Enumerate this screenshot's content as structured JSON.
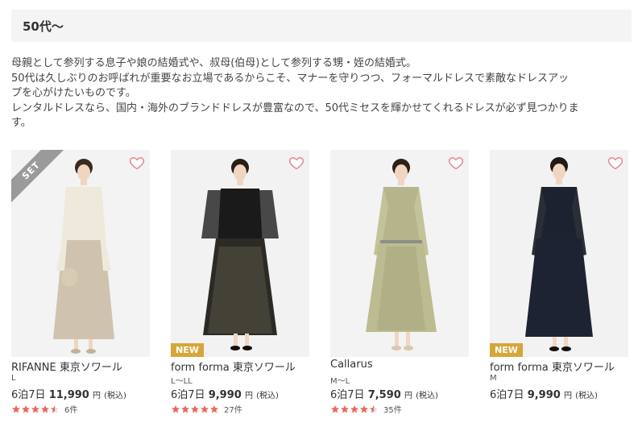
{
  "section": {
    "title": "50代〜"
  },
  "description": [
    "母親として参列する息子や娘の結婚式や、叔母(伯母)として参列する甥・姪の結婚式。",
    "50代は久しぶりのお呼ばれが重要なお立場であるからこそ、マナーを守りつつ、フォーマルドレスで素敵なドレスアッ",
    "プを心がけたいものです。",
    "レンタルドレスなら、国内・海外のブランドドレスが豊富なので、50代ミセスを輝かせてくれるドレスが必ず見つかりま",
    "す。"
  ],
  "colors": {
    "accent_heart": "#e48a8a",
    "star": "#e86a5a",
    "new_badge": "#d7a63a"
  },
  "products": [
    {
      "brand": "RIFANNE 東京ソワール",
      "size": "L",
      "period": "6泊7日",
      "price": "11,990",
      "yen": "円",
      "tax": "(税込)",
      "rating": 4.5,
      "reviews": "6件",
      "badge": "SET",
      "badge_type": "set",
      "favorite_icon": "heart-outline-icon"
    },
    {
      "brand": "form forma 東京ソワール",
      "size": "L〜LL",
      "period": "6泊7日",
      "price": "9,990",
      "yen": "円",
      "tax": "(税込)",
      "rating": 5,
      "reviews": "27件",
      "badge": "NEW",
      "badge_type": "new",
      "favorite_icon": "heart-outline-icon"
    },
    {
      "brand": "Callarus",
      "size": "M〜L",
      "period": "6泊7日",
      "price": "7,590",
      "yen": "円",
      "tax": "(税込)",
      "rating": 4.5,
      "reviews": "35件",
      "badge": "",
      "badge_type": "none",
      "favorite_icon": "heart-outline-icon"
    },
    {
      "brand": "form forma 東京ソワール",
      "size": "M",
      "period": "6泊7日",
      "price": "9,990",
      "yen": "円",
      "tax": "(税込)",
      "rating": 0,
      "reviews": "",
      "badge": "NEW",
      "badge_type": "new",
      "favorite_icon": "heart-outline-icon"
    }
  ]
}
